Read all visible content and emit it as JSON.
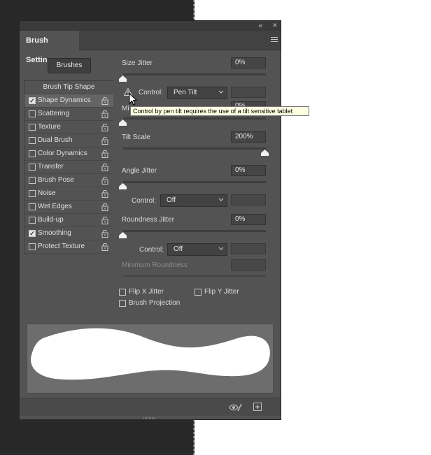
{
  "panel": {
    "collapse_glyph": "«",
    "close_glyph": "✕",
    "tab_title": "Brush Settings"
  },
  "brushes_button": "Brushes",
  "sidebar": {
    "header": "Brush Tip Shape",
    "items": [
      {
        "label": "Shape Dynamics",
        "checked": true,
        "selected": true
      },
      {
        "label": "Scattering",
        "checked": false
      },
      {
        "label": "Texture",
        "checked": false
      },
      {
        "label": "Dual Brush",
        "checked": false
      },
      {
        "label": "Color Dynamics",
        "checked": false
      },
      {
        "label": "Transfer",
        "checked": false
      },
      {
        "label": "Brush Pose",
        "checked": false
      },
      {
        "label": "Noise",
        "checked": false
      },
      {
        "label": "Wet Edges",
        "checked": false
      },
      {
        "label": "Build-up",
        "checked": false
      },
      {
        "label": "Smoothing",
        "checked": true
      },
      {
        "label": "Protect Texture",
        "checked": false
      }
    ]
  },
  "settings": {
    "size_jitter": {
      "label": "Size Jitter",
      "value": "0%"
    },
    "size_control": {
      "label": "Control:",
      "value": "Pen Tilt"
    },
    "minimum_diameter": {
      "label_partial": "Mi",
      "value_partial": "0%"
    },
    "tilt_scale": {
      "label": "Tilt Scale",
      "value": "200%"
    },
    "angle_jitter": {
      "label": "Angle Jitter",
      "value": "0%"
    },
    "angle_control": {
      "label": "Control:",
      "value": "Off"
    },
    "roundness_jitter": {
      "label": "Roundness Jitter",
      "value": "0%"
    },
    "roundness_control": {
      "label": "Control:",
      "value": "Off"
    },
    "minimum_roundness": {
      "label": "Minimum Roundness"
    },
    "flip_x": "Flip X Jitter",
    "flip_y": "Flip Y Jitter",
    "brush_projection": "Brush Projection"
  },
  "tooltip": "Control by pen tilt requires the use of a tilt sensitive tablet",
  "colors": {
    "panel_bg": "#535353",
    "preview_bg": "#6d6d6d",
    "tooltip_bg": "#ffffe1",
    "stroke": "#ffffff"
  }
}
